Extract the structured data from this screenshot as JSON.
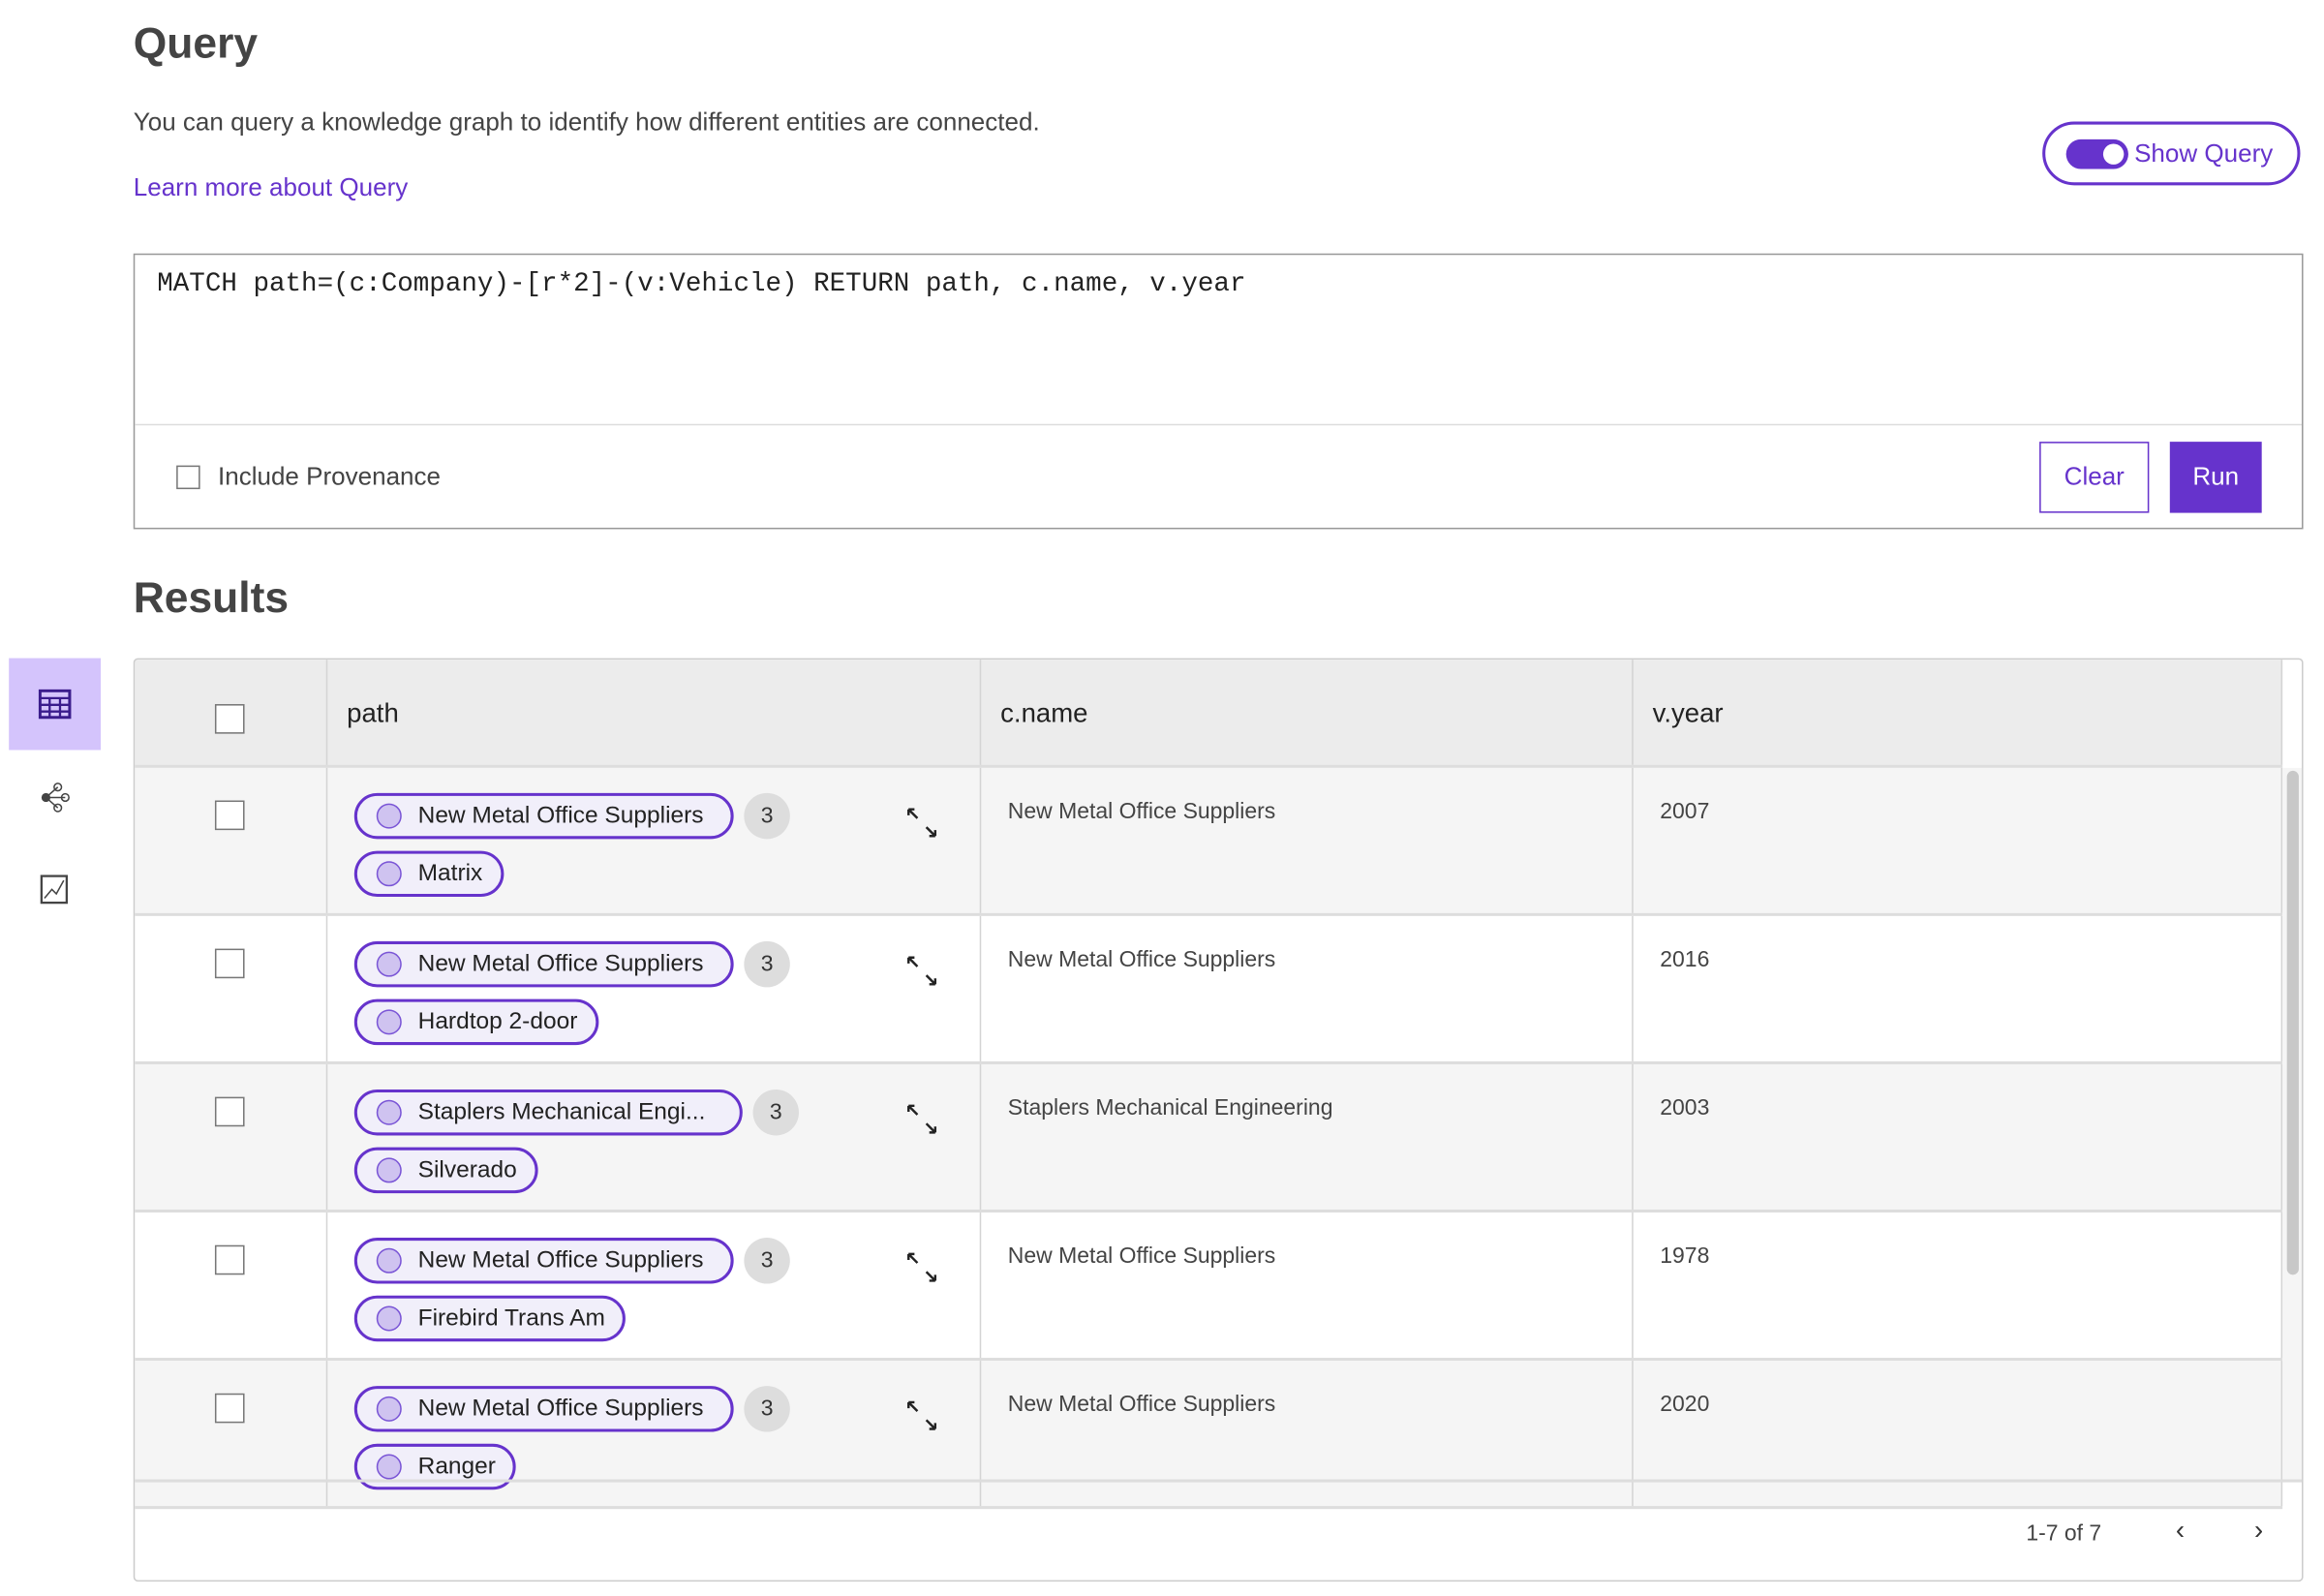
{
  "header": {
    "title": "Query",
    "description": "You can query a knowledge graph to identify how different entities are connected.",
    "learn_more": "Learn more about Query",
    "show_query_label": "Show Query",
    "show_query_on": true
  },
  "query": {
    "text": "MATCH path=(c:Company)-[r*2]-(v:Vehicle) RETURN path, c.name, v.year",
    "include_provenance_label": "Include Provenance",
    "include_provenance_checked": false,
    "clear_label": "Clear",
    "run_label": "Run"
  },
  "results": {
    "title": "Results",
    "columns": [
      "path",
      "c.name",
      "v.year"
    ],
    "rows": [
      {
        "from": "New Metal Office Suppliers",
        "count": "3",
        "to": "Matrix",
        "name": "New Metal Office Suppliers",
        "year": "2007"
      },
      {
        "from": "New Metal Office Suppliers",
        "count": "3",
        "to": "Hardtop 2-door",
        "name": "New Metal Office Suppliers",
        "year": "2016"
      },
      {
        "from": "Staplers Mechanical Engi...",
        "count": "3",
        "to": "Silverado",
        "name": "Staplers Mechanical Engineering",
        "year": "2003"
      },
      {
        "from": "New Metal Office Suppliers",
        "count": "3",
        "to": "Firebird Trans Am",
        "name": "New Metal Office Suppliers",
        "year": "1978"
      },
      {
        "from": "New Metal Office Suppliers",
        "count": "3",
        "to": "Ranger",
        "name": "New Metal Office Suppliers",
        "year": "2020"
      }
    ],
    "pagination": "1-7 of 7"
  },
  "sidebar": {
    "items": [
      "table-view-icon",
      "graph-view-icon",
      "chart-view-icon"
    ],
    "active": "table-view-icon"
  },
  "colors": {
    "accent": "#6633cc",
    "active_bg": "#d4c4fc"
  }
}
